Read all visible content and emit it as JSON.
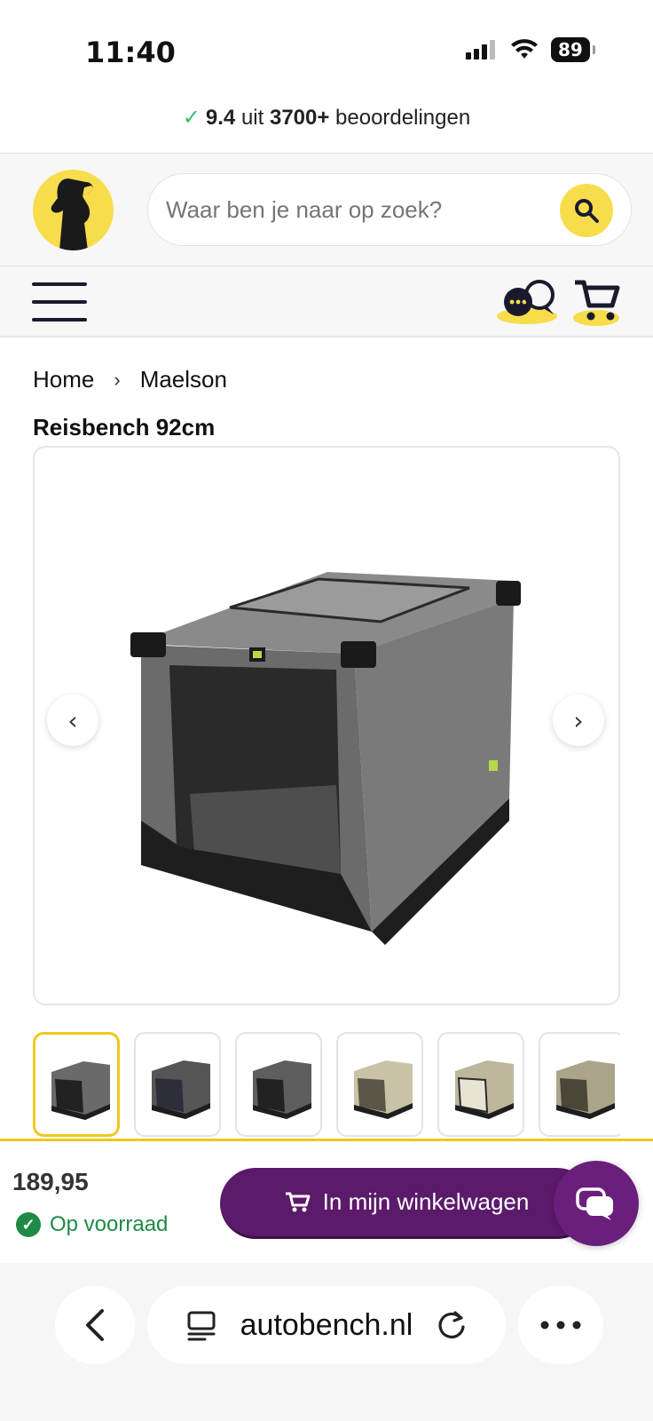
{
  "status": {
    "time": "11:40",
    "battery": "89"
  },
  "rating": {
    "score": "9.4",
    "middle": " uit ",
    "count": "3700+",
    "suffix": " beoordelingen"
  },
  "search": {
    "placeholder": "Waar ben je naar op zoek?"
  },
  "breadcrumb": {
    "items": [
      "Home",
      "Maelson"
    ]
  },
  "product": {
    "title": "Reisbench 92cm",
    "price": "189,95",
    "stock": "Op voorraad",
    "add_to_cart": "In mijn winkelwagen",
    "thumbnail_colors": [
      "grey",
      "grey",
      "grey",
      "beige",
      "beige",
      "beige"
    ]
  },
  "browser": {
    "url": "autobench.nl"
  },
  "colors": {
    "accent_yellow": "#f7dd4b",
    "brand_purple": "#5c1a6b",
    "stock_green": "#1f8a45"
  }
}
